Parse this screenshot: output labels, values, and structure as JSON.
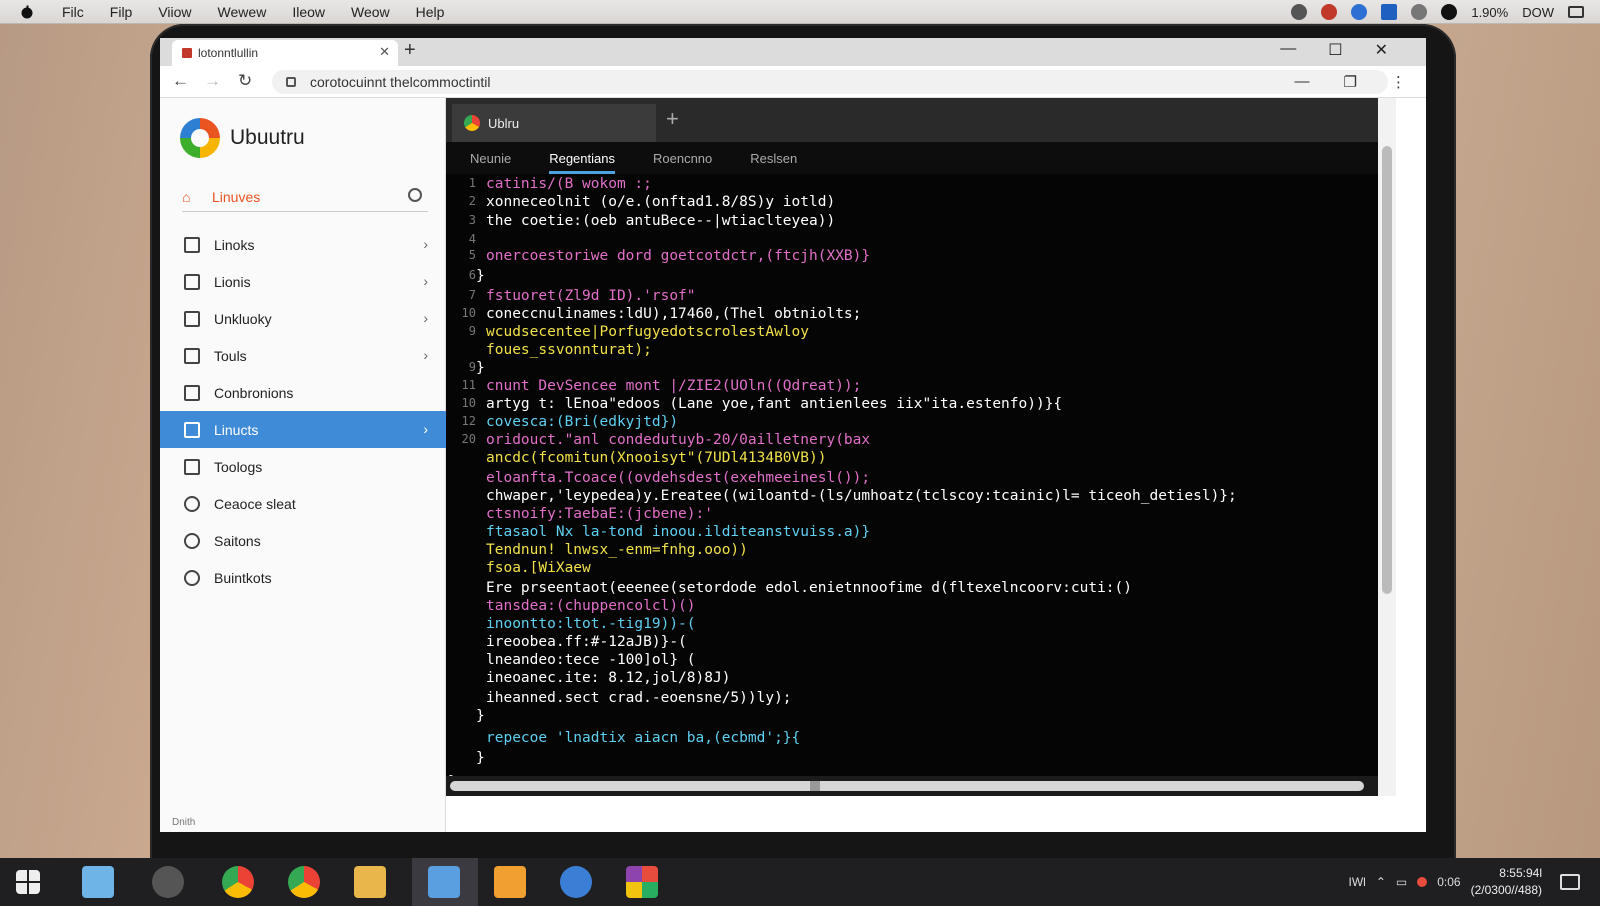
{
  "menubar": {
    "items": [
      "Filc",
      "Filp",
      "Viiow",
      "Wewew",
      "Ileow",
      "Weow",
      "Help"
    ],
    "right_text": [
      "1.90%",
      "DOW"
    ]
  },
  "browser": {
    "tab_title": "lotonntlullin",
    "url": "corotocuinnt thelcommoctintil"
  },
  "sidebar": {
    "brand": "Ubuutru",
    "search_label": "Linuves",
    "items": [
      {
        "label": "Linoks",
        "chevron": true
      },
      {
        "label": "Lionis",
        "chevron": true
      },
      {
        "label": "Unkluoky",
        "chevron": true
      },
      {
        "label": "Touls",
        "chevron": true
      },
      {
        "label": "Conbronions",
        "chevron": false
      },
      {
        "label": "Linucts",
        "chevron": true,
        "active": true
      },
      {
        "label": "Toologs",
        "chevron": false
      },
      {
        "label": "Ceaoce sleat",
        "chevron": false
      },
      {
        "label": "Saitons",
        "chevron": false
      },
      {
        "label": "Buintkots",
        "chevron": false
      }
    ],
    "footer": "Dnith"
  },
  "editor": {
    "tab_title": "Ublru",
    "subtabs": [
      "Neunie",
      "Regentians",
      "Roencnno",
      "Reslsen"
    ],
    "selected_subtab": "Regentians",
    "lines": [
      {
        "n": "1",
        "text": "catinis/(B wokom :;",
        "color": "#e070c8"
      },
      {
        "n": "2",
        "text": "xonneceolnit (o/e.(onftad1.8/8S)y iotld)",
        "color": "#ffffff"
      },
      {
        "n": "3",
        "text": "the coetie:(oeb antuBece--|wtiaclteyea))",
        "color": "#ffffff"
      },
      {
        "n": "4",
        "text": "",
        "color": "#ffffff"
      },
      {
        "n": "5",
        "text": "onercoestoriwe dord goetcotdctr,(ftcjh(XXB)}",
        "color": "#e070c8"
      },
      {
        "n": "6",
        "text": "}",
        "color": "#ffffff"
      },
      {
        "n": "7",
        "text": "fstuoret(Zl9d ID).'rsof\"",
        "color": "#e070c8"
      },
      {
        "n": "10",
        "text": "coneccnulinames:ldU),17460,(Thel obtniolts;",
        "color": "#ffffff"
      },
      {
        "n": "9",
        "text": "wcudsecentee|PorfugyedotscrolestAwloy",
        "color": "#f0e04a"
      },
      {
        "n": "",
        "text": "foues_ssvonnturat);",
        "color": "#f0e04a"
      },
      {
        "n": "9",
        "text": "}",
        "color": "#ffffff"
      },
      {
        "n": "11",
        "text": "cnunt DevSencee mont |/ZIE2(UOln((Qdreat));",
        "color": "#e070c8"
      },
      {
        "n": "10",
        "text": "artyg t: lEnoa\"edoos (Lane yoe,fant antienlees iix\"ita.estenfo))}{",
        "color": "#ffffff"
      },
      {
        "n": "12",
        "text": "covesca:(Bri(edkyjtd})",
        "color": "#5fd0f0"
      },
      {
        "n": "20",
        "text": "oridouct.\"anl condedutuyb-20/0ailletnery(bax",
        "color": "#e070c8"
      },
      {
        "n": "",
        "text": "ancdc(fcomitun(Xnooisyt\"(7UDl4134B0VB))",
        "color": "#f0e04a"
      },
      {
        "n": "",
        "text": "eloanfta.Tcoace((ovdehsdest(exehmeeinesl());",
        "color": "#e070c8"
      },
      {
        "n": "",
        "text": "chwaper,'leypedea)y.Ereatee((wiloantd-(ls/umhoatz(tclscoy:tcainic)l= ticeoh_detiesl)};",
        "color": "#ffffff"
      },
      {
        "n": "",
        "text": "ctsnoify:TaebaE:(jcbene):'",
        "color": "#e070c8"
      },
      {
        "n": "",
        "text": "ftasaol Nx la-tond inoou.ilditeanstvuiss.a)}",
        "color": "#5fd0f0"
      },
      {
        "n": "",
        "text": "Tendnun! lnwsx_-enm=fnhg.ooo))",
        "color": "#f0e04a"
      },
      {
        "n": "",
        "text": "fsoa.[WiXaew",
        "color": "#f0e04a"
      },
      {
        "n": "",
        "text": "Ere prseentaot(eeenee(setordode edol.enietnnoofime d(fltexelncoorv:cuti:()",
        "color": "#ffffff"
      },
      {
        "n": "",
        "text": "tansdea:(chuppencolcl)()",
        "color": "#e070c8"
      },
      {
        "n": "",
        "text": "inoontto:ltot.-tig19))-(",
        "color": "#5fd0f0"
      },
      {
        "n": "",
        "text": "ireoobea.ff:#-12aJB)}-(",
        "color": "#ffffff"
      },
      {
        "n": "",
        "text": "lneandeo:tece -100]ol} (",
        "color": "#ffffff"
      },
      {
        "n": "",
        "text": "ineoanec.ite: 8.12,jol/8)8J)",
        "color": "#ffffff"
      },
      {
        "n": "",
        "text": "iheanned.sect crad.-eoensne/5))ly);",
        "color": "#ffffff"
      },
      {
        "n": "",
        "text": "}",
        "color": "#ffffff"
      },
      {
        "n": "",
        "text": "repecoe 'lnadtix aiacn ba,(ecbmd';}{",
        "color": "#5fd0f0"
      },
      {
        "n": "",
        "text": "}",
        "color": "#ffffff"
      },
      {
        "n": "",
        "text": "}",
        "color": "#ffffff"
      }
    ]
  },
  "taskbar": {
    "tray_text": "IWl",
    "time": "8:55:94l",
    "date": "(2/0300//488)",
    "extra": "0:06"
  }
}
